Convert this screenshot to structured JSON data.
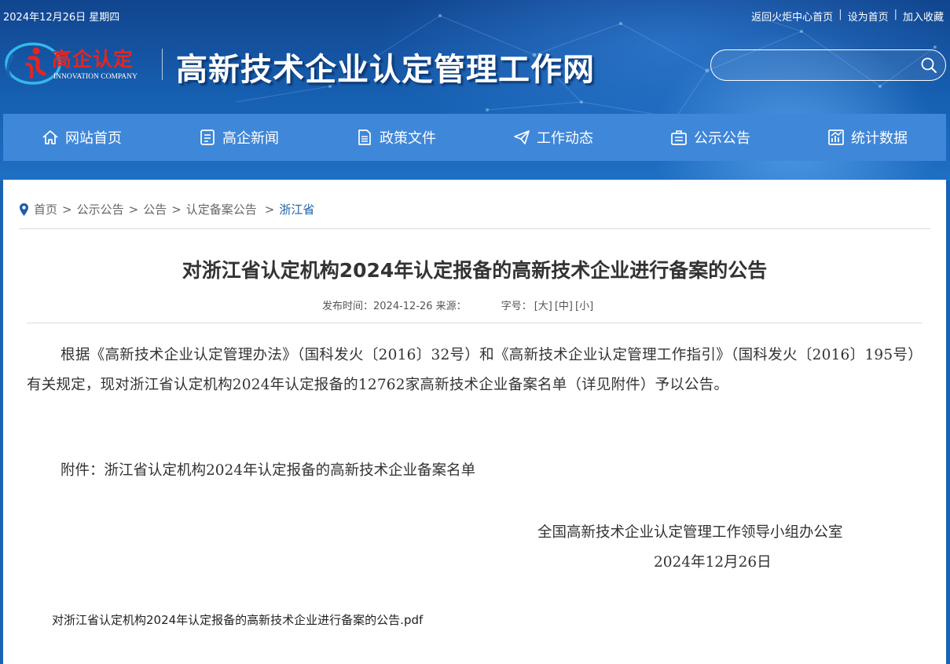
{
  "topbar": {
    "date": "2024年12月26日 星期四",
    "links": [
      "返回火炬中心首页",
      "设为首页",
      "加入收藏"
    ],
    "separator": "|"
  },
  "logo": {
    "name_cn": "高企认定",
    "name_en": "INNOVATION COMPANY"
  },
  "site_title": "高新技术企业认定管理工作网",
  "search": {
    "placeholder": ""
  },
  "nav": {
    "items": [
      {
        "label": "网站首页",
        "icon": "home-icon"
      },
      {
        "label": "高企新闻",
        "icon": "news-icon"
      },
      {
        "label": "政策文件",
        "icon": "document-icon"
      },
      {
        "label": "工作动态",
        "icon": "send-icon"
      },
      {
        "label": "公示公告",
        "icon": "notice-icon"
      },
      {
        "label": "统计数据",
        "icon": "chart-icon"
      }
    ]
  },
  "breadcrumb": {
    "items": [
      "首页",
      "公示公告",
      "公告",
      "认定备案公告"
    ],
    "current": "浙江省",
    "separator": ">"
  },
  "article": {
    "title": "对浙江省认定机构2024年认定报备的高新技术企业进行备案的公告",
    "meta_publish": "发布时间：2024-12-26 来源：",
    "font_size_label": "字号：",
    "font_sizes": [
      "[大]",
      "[中]",
      "[小]"
    ],
    "body": "根据《高新技术企业认定管理办法》（国科发火〔2016〕32号）和《高新技术企业认定管理工作指引》（国科发火〔2016〕195号）有关规定，现对浙江省认定机构2024年认定报备的12762家高新技术企业备案名单（详见附件）予以公告。",
    "attachment": "附件：浙江省认定机构2024年认定报备的高新技术企业备案名单",
    "signature_org": "全国高新技术企业认定管理工作领导小组办公室",
    "signature_date": "2024年12月26日",
    "pdf_link": "对浙江省认定机构2024年认定报备的高新技术企业进行备案的公告.pdf"
  },
  "colors": {
    "header_blue": "#1760b2",
    "nav_blue": "#3f87d9",
    "logo_red": "#e52521",
    "breadcrumb_current": "#1f5fa8"
  }
}
